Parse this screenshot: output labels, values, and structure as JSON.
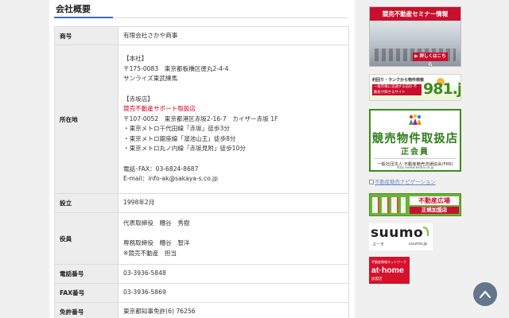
{
  "section": {
    "title": "会社概要"
  },
  "table": {
    "rows": {
      "name": {
        "label": "商号",
        "value": "有限会社さかや商事"
      },
      "address": {
        "label": "所在地",
        "lines": [
          "【本社】",
          "〒175-0083　東京都板橋区徳丸2-4-4",
          "サンライズ東武練馬",
          "",
          "【赤坂店】",
          "競売不動産サポート取扱店",
          "〒107-0052　東京都港区赤坂2-16-7　カイザー赤坂 1F",
          "・東京メトロ千代田線「赤坂」徒歩3分",
          "・東京メトロ銀座線「溜池山王」徒歩8分",
          "・東京メトロ丸ノ内線「赤坂見附」徒歩10分",
          "",
          "電話･FAX：03-6824-8687",
          "E-mail：info-ak@sakaya-s.co.jp"
        ]
      },
      "established": {
        "label": "設立",
        "value": "1998年2月"
      },
      "officers": {
        "label": "役員",
        "lines": [
          "代表取締役　糟谷　秀樹",
          "",
          "専務取締役　糟谷　智洋",
          "※競売不動産　担当"
        ]
      },
      "phone": {
        "label": "電話番号",
        "value": "03-3936-5848"
      },
      "fax": {
        "label": "FAX番号",
        "value": "03-3936-5869"
      },
      "license": {
        "label": "免許番号",
        "value": "東京都知事免許(6) 76256"
      }
    }
  },
  "sidebar": {
    "seminar": {
      "title": "競売不動産セミナー情報",
      "button": "▶ 詳しくはこちら"
    },
    "b981": {
      "line1": "利回り・ランクから物件検索",
      "line2": "一般市場に流通する前の 不動産が探せるサイト",
      "number": "981.jp"
    },
    "badge": {
      "title": "競売物件取扱店",
      "subtitle": "正会員",
      "org": "一般社団法人 不動産競売流通協会(FKR)",
      "url": "http://www.keibai.or.jp"
    },
    "broken_link": {
      "text": "不動産競売ナビゲーション"
    },
    "hiroba": {
      "title": "不動産広場",
      "subtitle": "正規加盟店"
    },
    "suumo": {
      "logo": "suumo",
      "sub": "スーモ",
      "url": "suumo.jp"
    },
    "athome": {
      "top": "不動産情報ネットワーク",
      "logo": "at·home",
      "sub": "加盟店"
    }
  },
  "colors": {
    "accent_red": "#c8102e",
    "accent_green": "#3c8a1c",
    "title_blue": "#3b6fb6",
    "totop_bg": "#5a6b86"
  },
  "icons": {
    "totop": "chevron-up-icon"
  }
}
